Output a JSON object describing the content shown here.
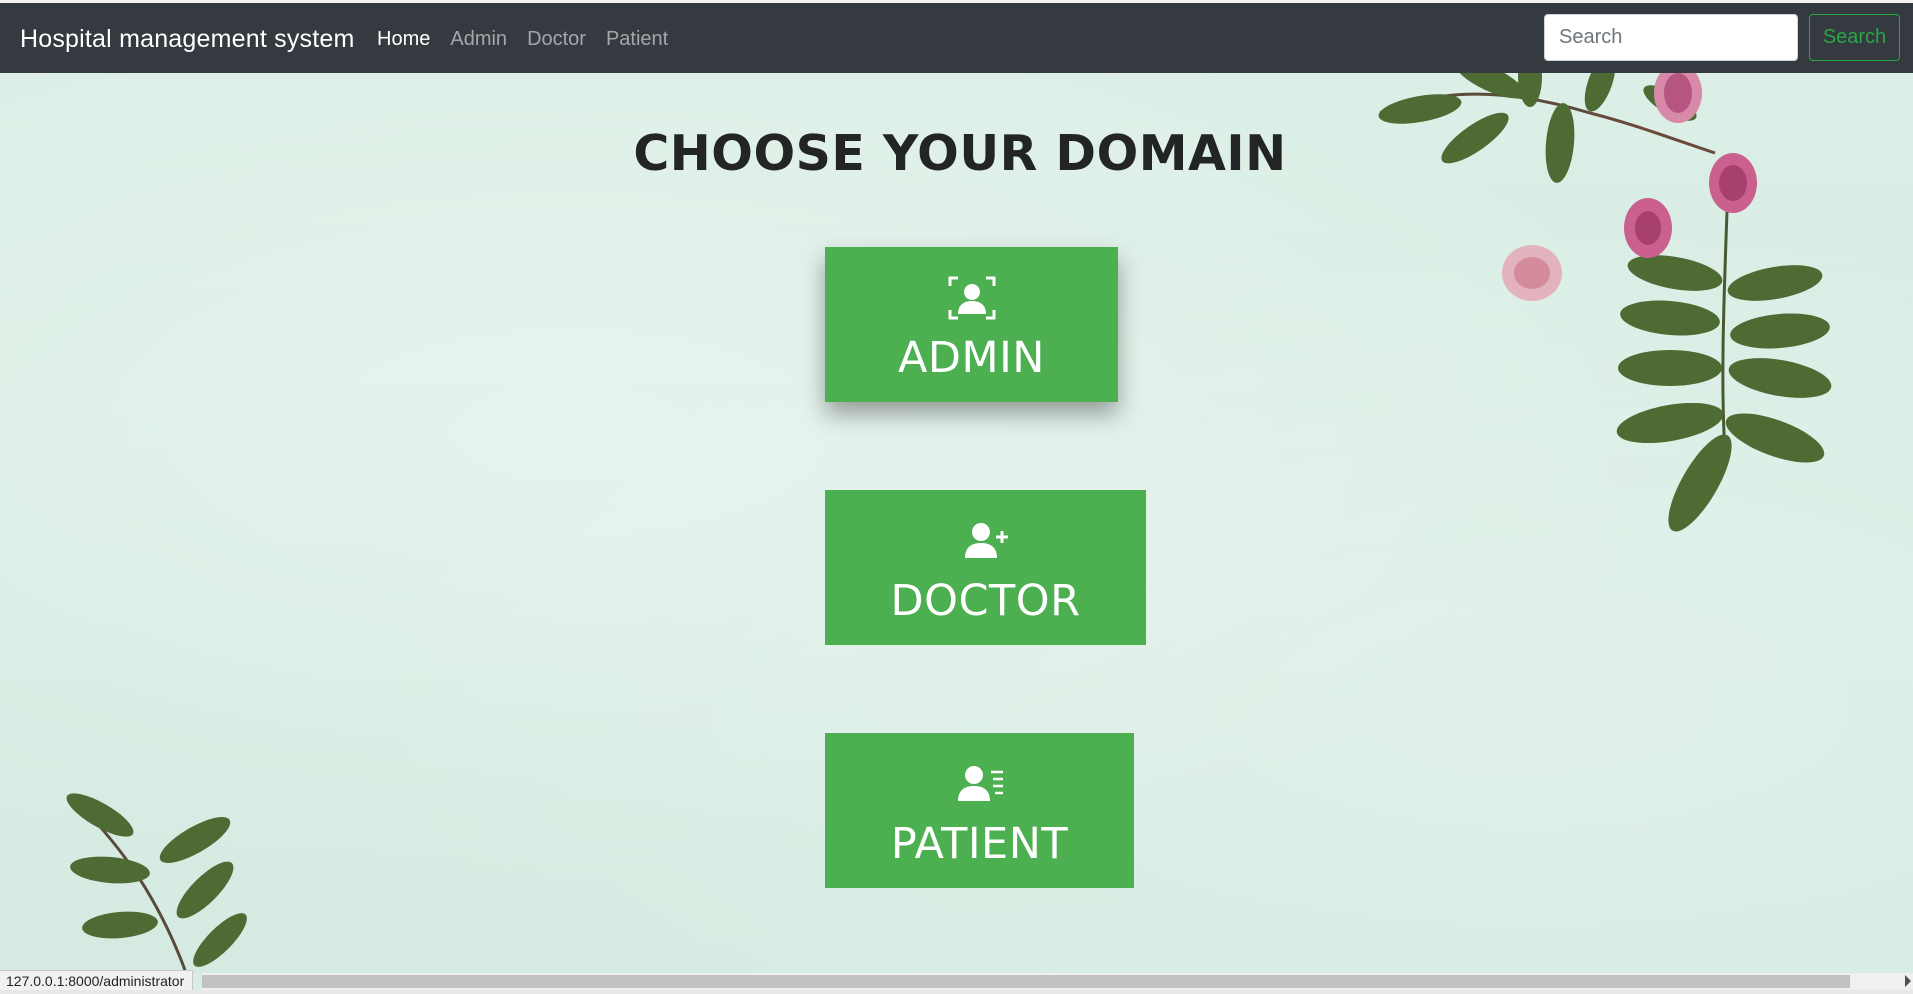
{
  "navbar": {
    "brand": "Hospital management system",
    "links": [
      {
        "label": "Home",
        "active": true
      },
      {
        "label": "Admin",
        "active": false
      },
      {
        "label": "Doctor",
        "active": false
      },
      {
        "label": "Patient",
        "active": false
      }
    ],
    "search": {
      "placeholder": "Search",
      "value": "",
      "button_label": "Search"
    }
  },
  "main": {
    "heading": "CHOOSE YOUR DOMAIN",
    "domains": [
      {
        "label": "ADMIN",
        "icon": "user-scan-icon"
      },
      {
        "label": "DOCTOR",
        "icon": "user-plus-icon"
      },
      {
        "label": "PATIENT",
        "icon": "user-list-icon"
      }
    ]
  },
  "status_bar": {
    "url": "127.0.0.1:8000/administrator"
  },
  "colors": {
    "navbar_bg": "#343a40",
    "domain_button_bg": "#4caf50",
    "search_button_accent": "#28a745",
    "page_bg": "#d9ece3"
  }
}
